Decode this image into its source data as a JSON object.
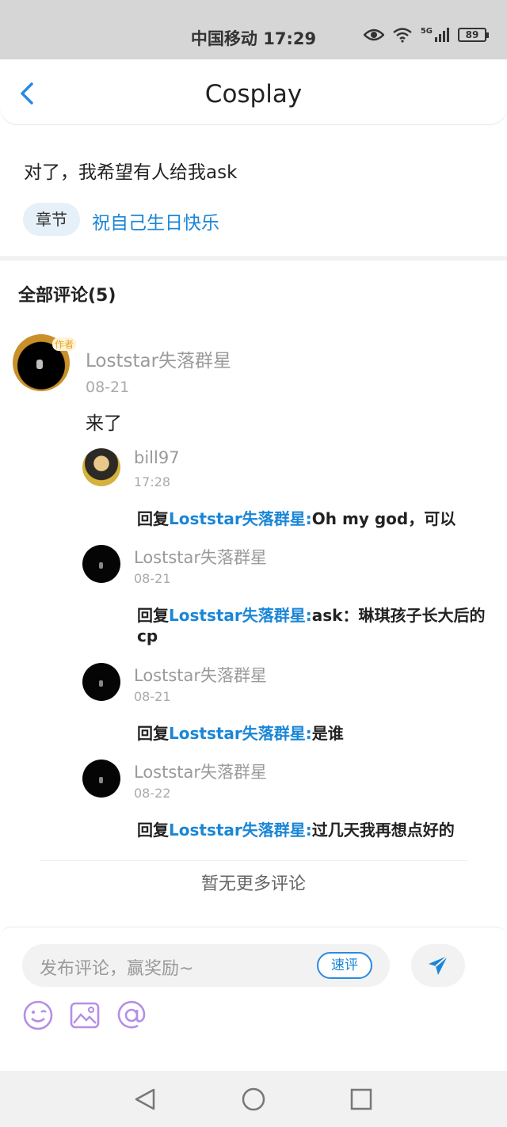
{
  "status_bar": {
    "carrier_time": "中国移动 17:29",
    "network": "5G",
    "battery": "89"
  },
  "nav": {
    "title": "Cosplay"
  },
  "post": {
    "text": "对了，我希望有人给我ask",
    "chapter_tag": "章节",
    "chapter_title": "祝自己生日快乐"
  },
  "comments": {
    "title": "全部评论(5)",
    "main": {
      "author": "Loststar失落群星",
      "badge": "作者",
      "date": "08-21",
      "content": "来了"
    },
    "replies": [
      {
        "author": "bill97",
        "date": "17:28",
        "prefix": "回复",
        "mention": "Loststar失落群星:",
        "text": "Oh my god，可以"
      },
      {
        "author": "Loststar失落群星",
        "date": "08-21",
        "prefix": "回复",
        "mention": "Loststar失落群星:",
        "text": "ask：琳琪孩子长大后的cp"
      },
      {
        "author": "Loststar失落群星",
        "date": "08-21",
        "prefix": "回复",
        "mention": "Loststar失落群星:",
        "text": "是谁"
      },
      {
        "author": "Loststar失落群星",
        "date": "08-22",
        "prefix": "回复",
        "mention": "Loststar失落群星:",
        "text": "过几天我再想点好的"
      }
    ],
    "no_more": "暂无更多评论"
  },
  "composer": {
    "placeholder": "发布评论，赢奖励~",
    "quick_label": "速评"
  },
  "colors": {
    "accent": "#1a86d6",
    "icon_purple": "#b58ee6"
  }
}
